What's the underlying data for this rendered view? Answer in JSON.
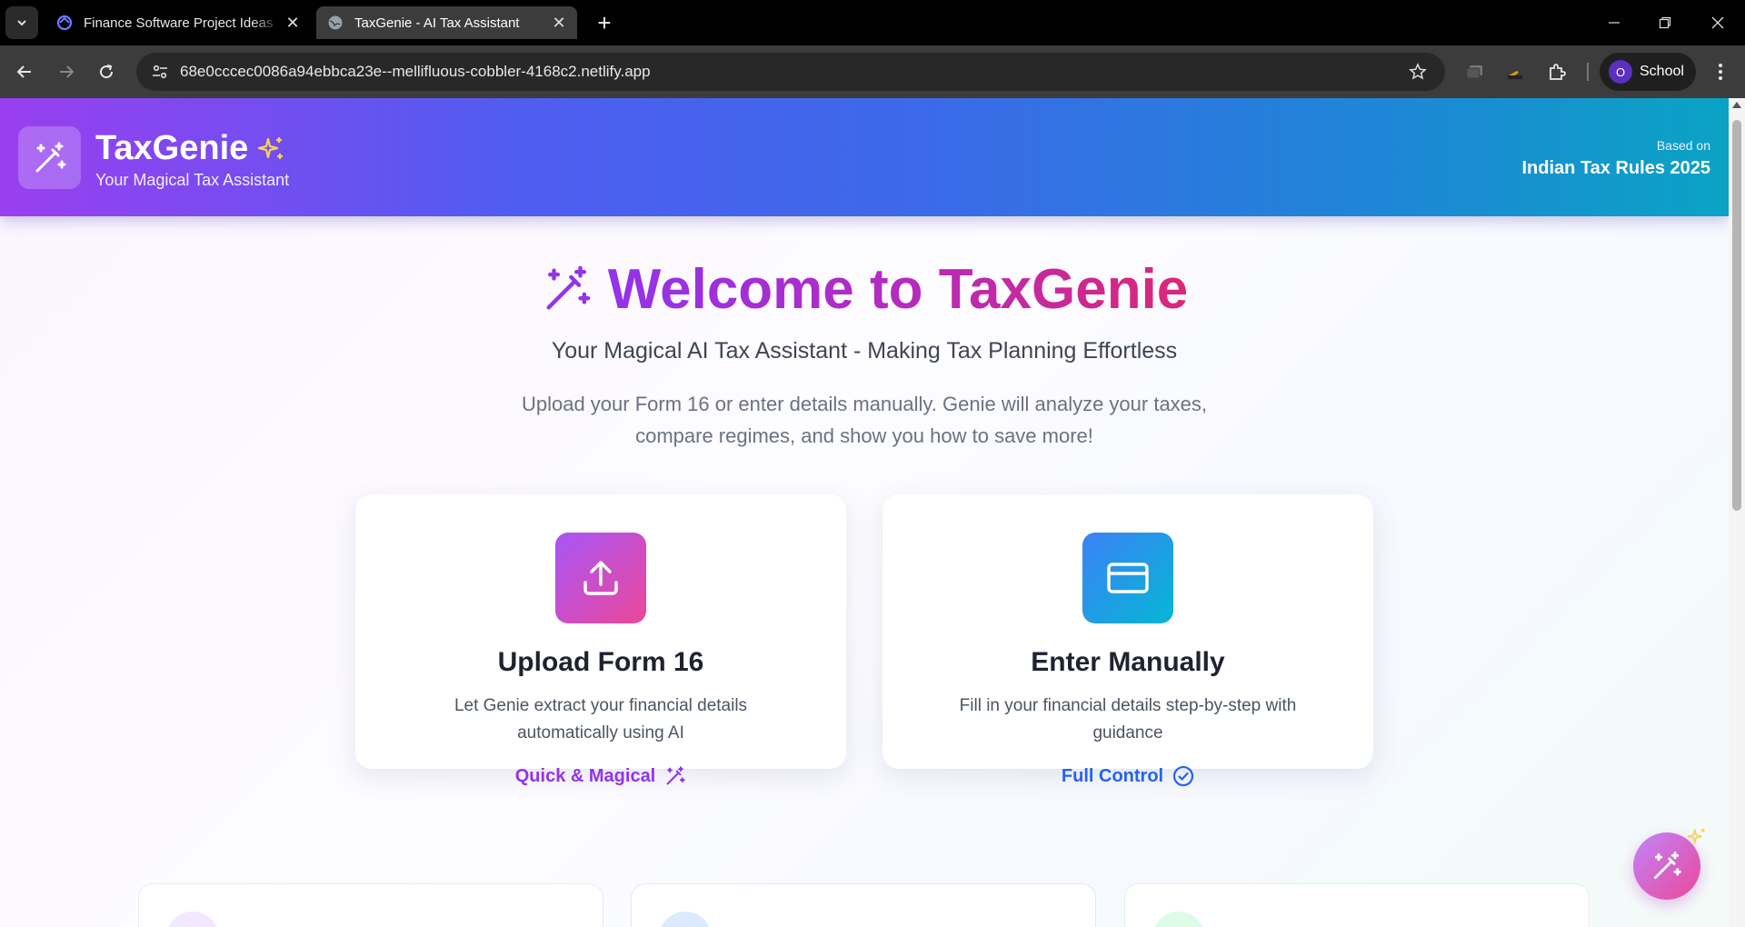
{
  "browser": {
    "tabs": [
      {
        "title": "Finance Software Project Ideas"
      },
      {
        "title": "TaxGenie - AI Tax Assistant"
      }
    ],
    "url": "68e0cccec0086a94ebbca23e--mellifluous-cobbler-4168c2.netlify.app",
    "profile": {
      "initial": "O",
      "name": "School"
    }
  },
  "header": {
    "brand": "TaxGenie",
    "tagline": "Your Magical Tax Assistant",
    "based_on_label": "Based on",
    "based_on_value": "Indian Tax Rules 2025"
  },
  "hero": {
    "title": "Welcome to TaxGenie",
    "subtitle": "Your Magical AI Tax Assistant - Making Tax Planning Effortless",
    "description": "Upload your Form 16 or enter details manually. Genie will analyze your taxes, compare regimes, and show you how to save more!"
  },
  "options": [
    {
      "title": "Upload Form 16",
      "description": "Let Genie extract your financial details automatically using AI",
      "link": "Quick & Magical",
      "icon": "upload-icon"
    },
    {
      "title": "Enter Manually",
      "description": "Fill in your financial details step-by-step with guidance",
      "link": "Full Control",
      "icon": "credit-card-icon"
    }
  ],
  "colors": {
    "header_gradient": [
      "#9a3ff0",
      "#3a6be8",
      "#0aa3c4"
    ],
    "purple_accent": "#9333ea",
    "blue_accent": "#2563eb",
    "pink_accent": "#db2777"
  }
}
